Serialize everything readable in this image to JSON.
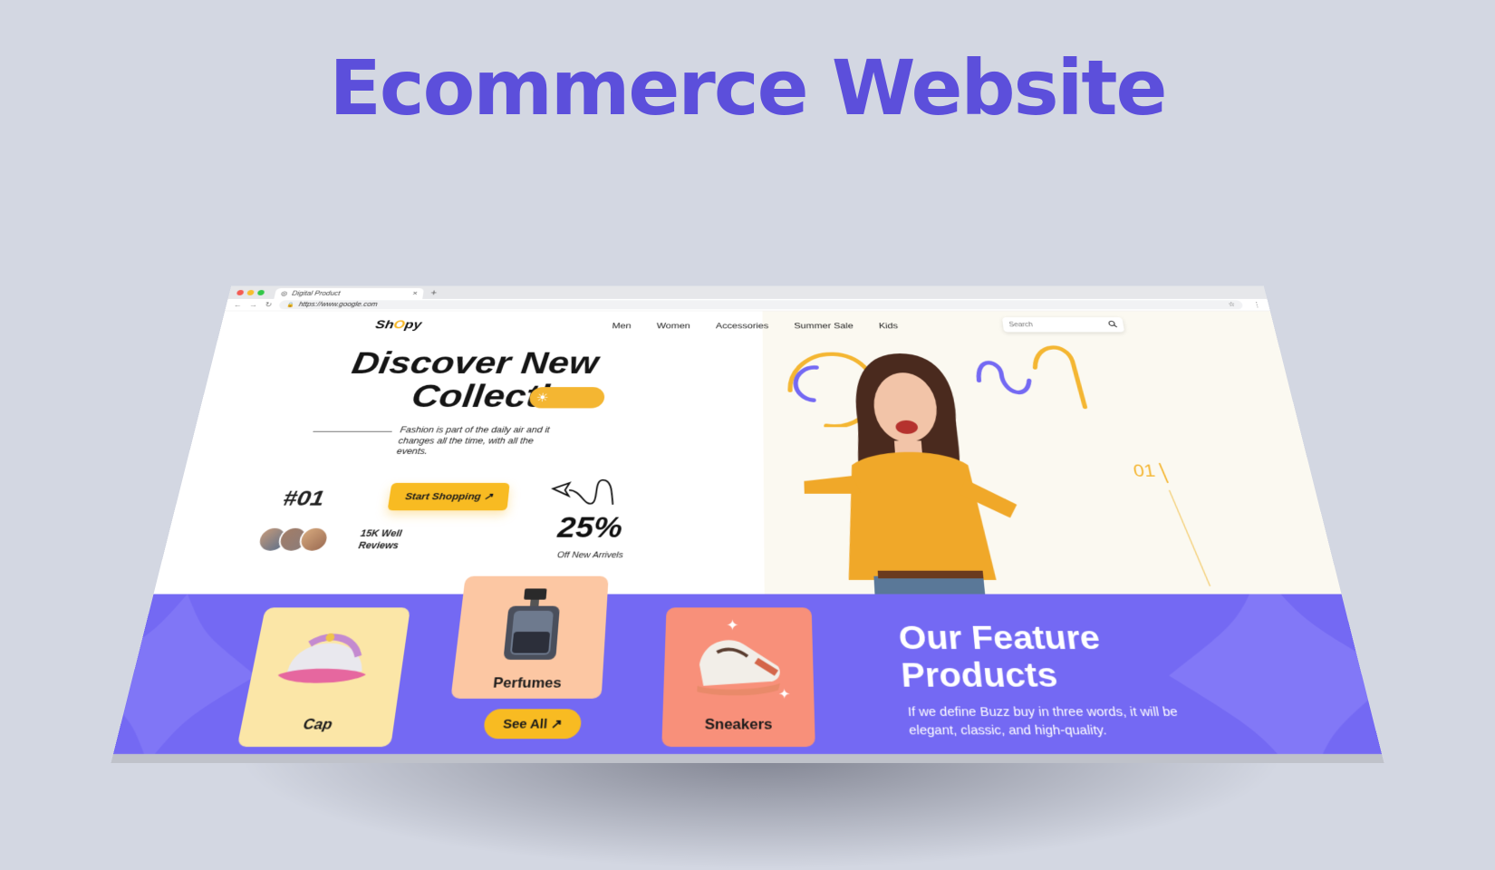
{
  "heading": "Ecommerce Website",
  "browser": {
    "tab_title": "Digital Product",
    "url": "https://www.google.com"
  },
  "site": {
    "logo_prefix": "Sh",
    "logo_o": "O",
    "logo_suffix": "py",
    "menu": [
      "Men",
      "Women",
      "Accessories",
      "Summer Sale",
      "Kids"
    ],
    "search_placeholder": "Search"
  },
  "hero": {
    "title_line1": "Discover New",
    "title_line2": "Collection",
    "description": "Fashion is part of the daily air and it changes all the time, with all the events.",
    "number": "#01",
    "cta": "Start Shopping",
    "reviews": "15K Well Reviews",
    "discount": "25%",
    "discount_label": "Off New Arrivels",
    "slide_number": "01"
  },
  "features": {
    "title_line1": "Our Feature",
    "title_line2": "Products",
    "description": "If we define Buzz buy in three words, it will be elegant, classic, and high-quality.",
    "products": [
      "Cap",
      "Perfumes",
      "Sneakers"
    ],
    "see_all": "See All"
  },
  "colors": {
    "accent": "#5c4fdb",
    "band": "#7469f3",
    "yellow": "#f8bb22",
    "cap_card": "#fbe6a7",
    "perfume_card": "#fcc7a3",
    "sneaker_card": "#f8907a"
  }
}
